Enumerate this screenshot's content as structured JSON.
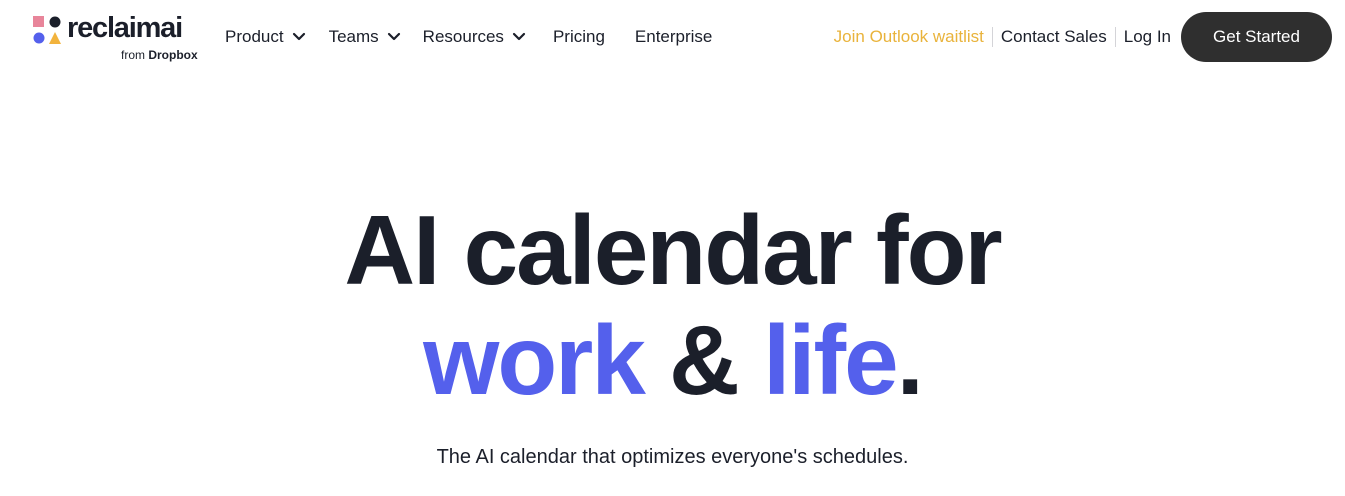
{
  "brand": {
    "name": "reclaimai",
    "from_label": "from",
    "from_brand": "Dropbox",
    "logo_colors": {
      "pink": "#e8859a",
      "dark": "#1b1f2a",
      "blue": "#5460ec",
      "yellow": "#f2b33d"
    }
  },
  "nav": {
    "items": [
      {
        "label": "Product",
        "has_dropdown": true,
        "icon": "chevron-down-icon"
      },
      {
        "label": "Teams",
        "has_dropdown": true,
        "icon": "chevron-down-icon"
      },
      {
        "label": "Resources",
        "has_dropdown": true,
        "icon": "chevron-down-icon"
      },
      {
        "label": "Pricing",
        "has_dropdown": false
      },
      {
        "label": "Enterprise",
        "has_dropdown": false
      }
    ]
  },
  "header_links": {
    "waitlist": "Join Outlook waitlist",
    "contact": "Contact Sales",
    "login": "Log In",
    "waitlist_color": "#e9b33b"
  },
  "cta": {
    "label": "Get Started",
    "background": "#2f2f2f"
  },
  "hero": {
    "line1": "AI calendar for",
    "line2_part1": "work",
    "line2_part2": " & ",
    "line2_part3": "life",
    "line2_part4": ".",
    "accent_color": "#5460ec",
    "subtitle": "The AI calendar that optimizes everyone's schedules."
  }
}
